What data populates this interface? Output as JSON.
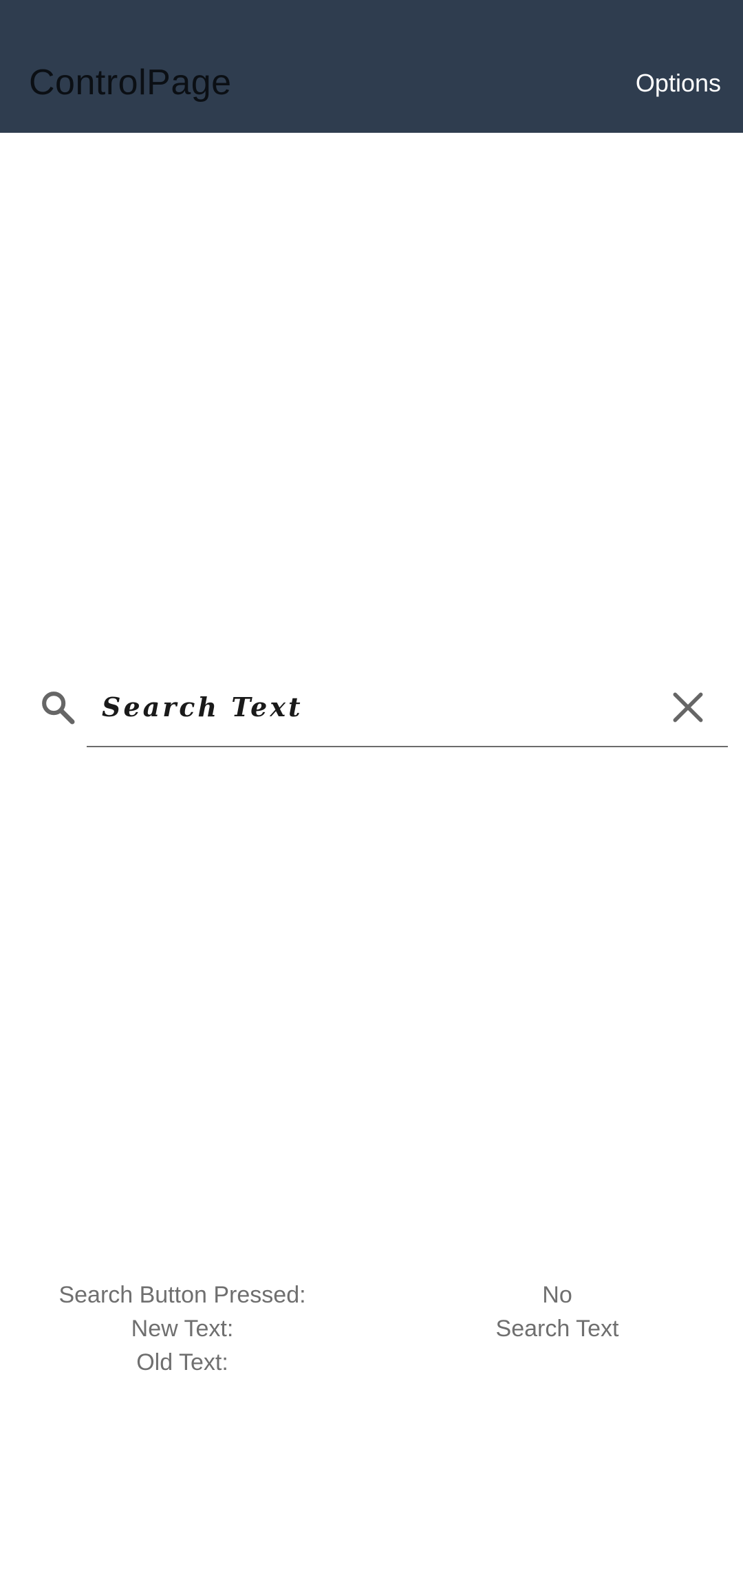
{
  "appbar": {
    "title": "ControlPage",
    "options_label": "Options",
    "background_color": "#2f3d4f"
  },
  "search": {
    "value": "Search Text",
    "search_icon": "search-icon",
    "clear_icon": "close-icon"
  },
  "status": {
    "rows": [
      {
        "label": "Search Button Pressed:",
        "value": "No"
      },
      {
        "label": "New Text:",
        "value": "Search Text"
      },
      {
        "label": "Old Text:",
        "value": ""
      }
    ]
  }
}
